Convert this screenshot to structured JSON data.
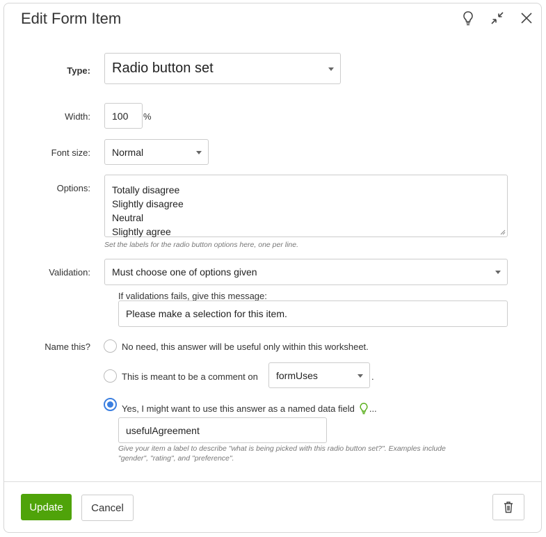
{
  "dialog": {
    "title": "Edit Form Item",
    "icons": [
      "lightbulb-icon",
      "compress-icon",
      "close-icon"
    ]
  },
  "form": {
    "type": {
      "label": "Type:",
      "value": "Radio button set"
    },
    "width": {
      "label": "Width:",
      "value": "100",
      "unit": "%"
    },
    "font_size": {
      "label": "Font size:",
      "value": "Normal"
    },
    "options": {
      "label": "Options:",
      "lines": [
        "Totally disagree",
        "Slightly disagree",
        "Neutral",
        "Slightly agree"
      ],
      "help": "Set the labels for the radio button options here, one per line."
    },
    "validation": {
      "label": "Validation:",
      "value": "Must choose one of options given",
      "message_label": "If validations fails, give this message:",
      "message_value": "Please make a selection for this item."
    },
    "name_this": {
      "label": "Name this?",
      "choices": [
        {
          "text": "No need, this answer will be useful only within this worksheet.",
          "selected": false
        },
        {
          "text": "This is meant to be a comment on",
          "select_value": "formUses",
          "suffix": ".",
          "selected": false
        },
        {
          "text": "Yes, I might want to use this answer as a named data field",
          "suffix": "...",
          "selected": true
        }
      ],
      "field_value": "usefulAgreement",
      "help_line1": "Give your item a label to describe \"what is being picked with this radio button set?\". Examples include",
      "help_line2": "\"gender\", \"rating\", and \"preference\"."
    }
  },
  "footer": {
    "update": "Update",
    "cancel": "Cancel",
    "delete_icon": "trash-icon"
  },
  "colors": {
    "accent_green": "#4fa30a",
    "radio_blue": "#3b7fe0",
    "hint_green": "#5aaf1c"
  }
}
